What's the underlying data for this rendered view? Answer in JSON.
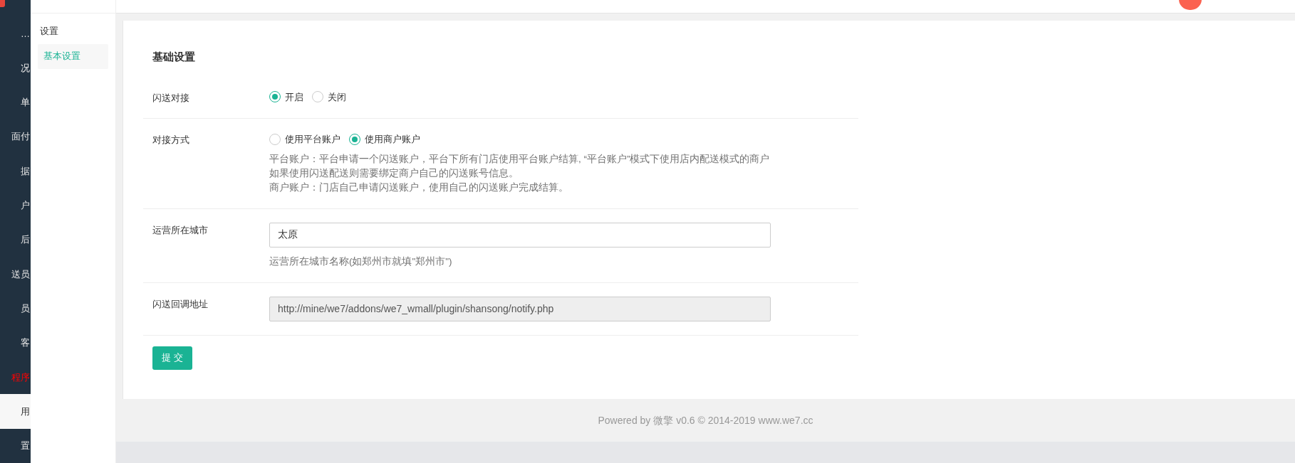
{
  "main_nav": {
    "items": [
      {
        "label": "…",
        "selected": false,
        "highlight": false
      },
      {
        "label": "况",
        "selected": false,
        "highlight": false
      },
      {
        "label": "单",
        "selected": false,
        "highlight": false
      },
      {
        "label": "面付",
        "selected": false,
        "highlight": false
      },
      {
        "label": "据",
        "selected": false,
        "highlight": false
      },
      {
        "label": "户",
        "selected": false,
        "highlight": false
      },
      {
        "label": "后",
        "selected": false,
        "highlight": false
      },
      {
        "label": "送员",
        "selected": false,
        "highlight": false
      },
      {
        "label": "员",
        "selected": false,
        "highlight": false
      },
      {
        "label": "客",
        "selected": false,
        "highlight": false
      },
      {
        "label": "程序",
        "selected": false,
        "highlight": true
      },
      {
        "label": "用",
        "selected": true,
        "highlight": false
      },
      {
        "label": "置",
        "selected": false,
        "highlight": false
      }
    ]
  },
  "sub_nav": {
    "heading": "设置",
    "items": [
      {
        "label": "基本设置",
        "selected": true
      }
    ]
  },
  "form": {
    "title": "基础设置",
    "rows": [
      {
        "kind": "radio",
        "label": "闪送对接",
        "options": [
          {
            "label": "开启",
            "selected": true
          },
          {
            "label": "关闭",
            "selected": false
          }
        ],
        "help": []
      },
      {
        "kind": "radio",
        "label": "对接方式",
        "options": [
          {
            "label": "使用平台账户",
            "selected": false
          },
          {
            "label": "使用商户账户",
            "selected": true
          }
        ],
        "help": [
          "平台账户：平台申请一个闪送账户，平台下所有门店使用平台账户结算, “平台账户”模式下使用店内配送模式的商户",
          "如果使用闪送配送则需要绑定商户自己的闪送账号信息。",
          "商户账户：门店自己申请闪送账户，使用自己的闪送账户完成结算。"
        ]
      },
      {
        "kind": "text",
        "label": "运营所在城市",
        "value": "太原",
        "disabled": false,
        "help": [
          "运营所在城市名称(如郑州市就填\"郑州市\")"
        ]
      },
      {
        "kind": "text",
        "label": "闪送回调地址",
        "value": "http://mine/we7/addons/we7_wmall/plugin/shansong/notify.php",
        "disabled": true,
        "help": []
      }
    ],
    "submit": "提 交"
  },
  "footer": "Powered by 微擎 v0.6 © 2014-2019 www.we7.cc"
}
